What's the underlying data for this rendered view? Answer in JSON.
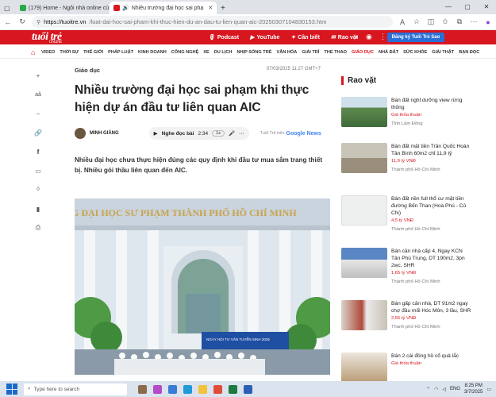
{
  "browser": {
    "tabs": [
      {
        "label": "(179) Home - Ngôi nhà online củ",
        "color": "#2aa84a"
      },
      {
        "label": "Nhiều trường đại học sai phạ",
        "color": "#d7161f",
        "active": true
      }
    ],
    "url_domain": "https://tuoitre.vn",
    "url_path": "/loat-dai-hoc-sai-pham-khi-thuc-hien-du-an-dau-tu-lien-quan-aic-20250307104830153.htm"
  },
  "site": {
    "logo": "tuổi trẻ",
    "logo_sub": "ONLINE",
    "top_links": [
      "Podcast",
      "YouTube",
      "Cần biết",
      "Rao vặt"
    ],
    "register": "Đăng ký Tuổi Trẻ Sao",
    "menu": [
      "VIDEO",
      "THỜI SỰ",
      "THẾ GIỚI",
      "PHÁP LUẬT",
      "KINH DOANH",
      "CÔNG NGHỆ",
      "XE",
      "DU LỊCH",
      "NHỊP SỐNG TRẺ",
      "VĂN HÓA",
      "GIẢI TRÍ",
      "THỂ THAO",
      "GIÁO DỤC",
      "NHÀ ĐẤT",
      "SỨC KHỎE",
      "GIẢI THẬT",
      "BẠN ĐỌC"
    ],
    "accent": "#d7161f"
  },
  "side_tools": {
    "zoom": "aâ",
    "count": "0"
  },
  "article": {
    "category": "Giáo dục",
    "date": "07/03/2025 11:27 GMT+7",
    "title": "Nhiều trường đại học sai phạm khi thực hiện dự án đầu tư liên quan AIC",
    "author": "MINH GIẢNG",
    "listen_label": "Nghe đọc bài",
    "listen_time": "2:34",
    "speed": "1x",
    "gnews_prefix": "Tuổi Trẻ trên",
    "gnews": "Google News",
    "lead": "Nhiều đại học chưa thực hiện đúng các quy định khi đầu tư mua sắm trang thiết bị. Nhiều gói thầu liên quan đến AIC.",
    "photo_sign": "G ĐẠI HỌC SƯ PHẠM THÀNH PHỐ HỒ CHÍ MINH",
    "banner_text": "NGÀY HỘI TƯ VẤN TUYỂN SINH 2025"
  },
  "rao_vat": {
    "heading": "Rao vặt",
    "items": [
      {
        "title": "Bán đất nghỉ dưỡng view rừng thông",
        "price": "Giá thỏa thuận",
        "loc": "Tỉnh Lâm Đồng"
      },
      {
        "title": "Bán đất mặt tiền Trần Quốc Hoàn Tân Bình 60m2 chỉ 11,9 tỷ",
        "price": "11,9 tỷ VNĐ",
        "loc": "Thành phố Hồ Chí Minh"
      },
      {
        "title": "Bán đất nền full thổ cư mặt tiền đường Bến Than (Hoà Phú - Củ Chi)",
        "price": "4,5 tỷ VNĐ",
        "loc": "Thành phố Hồ Chí Minh"
      },
      {
        "title": "Bán căn nhà cấp 4, Ngay KCN Tân Phú Trung, DT 190m2, 3pn 2wc, SHR",
        "price": "1,65 tỷ VNĐ",
        "loc": "Thành phố Hồ Chí Minh"
      },
      {
        "title": "Bán gấp căn nhà, DT 91m2 ngay chợ đầu mối Hóc Môn, 3 lầu, SHR",
        "price": "2,55 tỷ VNĐ",
        "loc": "Thành phố Hồ Chí Minh"
      },
      {
        "title": "Bán 2 cái đồng hồ cổ quả lắc",
        "price": "Giá thỏa thuận",
        "loc": ""
      }
    ]
  },
  "taskbar": {
    "search": "Type here to search",
    "lang": "ENG",
    "time": "8:25 PM",
    "date": "3/7/2025"
  }
}
